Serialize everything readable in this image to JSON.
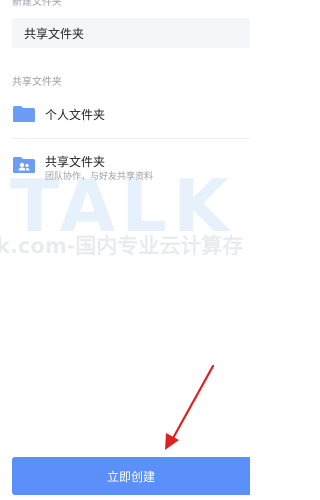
{
  "header": {
    "new_folder_label": "新建文件夹"
  },
  "name_input": {
    "value": "共享文件夹"
  },
  "section": {
    "label": "共享文件夹"
  },
  "options": [
    {
      "title": "个人文件夹",
      "description": "",
      "icon": "folder-icon"
    },
    {
      "title": "共享文件夹",
      "description": "团队协作，与好友共享资料",
      "icon": "shared-folder-icon"
    }
  ],
  "watermark": {
    "brand": "TALK",
    "text": "k.com-国内专业云计算存"
  },
  "footer": {
    "create_label": "立即创建"
  },
  "colors": {
    "accent": "#5b8ff9",
    "folder": "#6d9cf5",
    "annotation_arrow": "#e02020"
  }
}
